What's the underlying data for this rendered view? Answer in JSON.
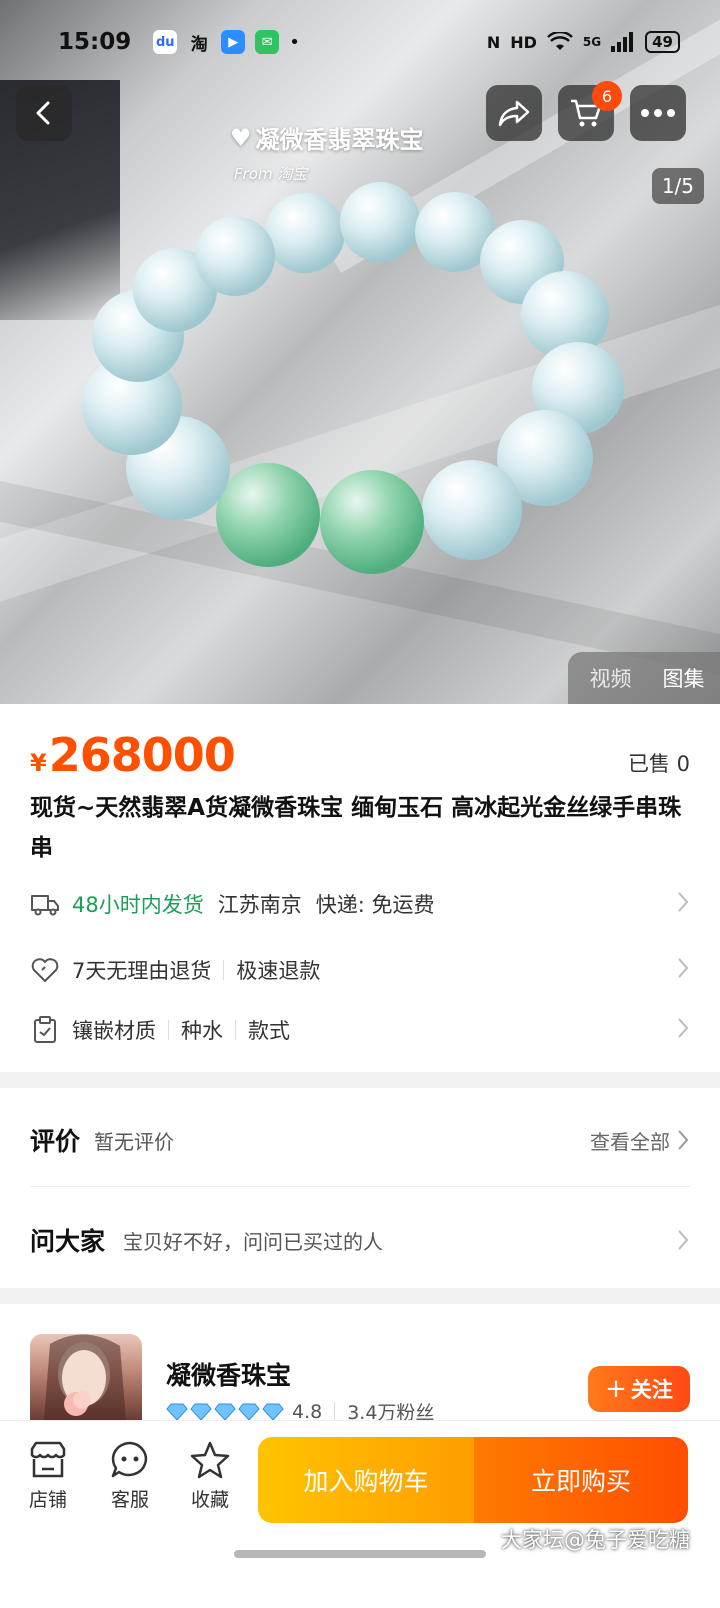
{
  "status_bar": {
    "time": "15:09",
    "apps": [
      "du",
      "淘",
      "▶",
      "✉"
    ],
    "network": "5G",
    "hd": "HD",
    "battery": "49"
  },
  "hero": {
    "watermark_title": "凝微香翡翠珠宝",
    "watermark_from": "From 淘宝",
    "page_indicator": "1/5",
    "media_tabs": [
      "视频",
      "图集"
    ],
    "cart_count": "6"
  },
  "product": {
    "currency": "¥",
    "price": "268000",
    "sold": "已售 0",
    "title": "现货~天然翡翠A货凝微香珠宝 缅甸玉石 高冰起光金丝绿手串珠串",
    "shipping": {
      "time": "48小时内发货",
      "origin": "江苏南京",
      "courier": "快递: 免运费"
    },
    "returns": {
      "policy": "7天无理由退货",
      "refund": "极速退款"
    },
    "specs": [
      "镶嵌材质",
      "种水",
      "款式"
    ]
  },
  "reviews": {
    "title": "评价",
    "empty": "暂无评价",
    "view_all": "查看全部",
    "ask_title": "问大家",
    "ask_sub": "宝贝好不好，问问已买过的人"
  },
  "shop": {
    "name": "凝微香珠宝",
    "rating": "4.8",
    "fans": "3.4万粉丝",
    "follow_label": "关注"
  },
  "bottom_bar": {
    "store_label": "店铺",
    "service_label": "客服",
    "fav_label": "收藏",
    "add_cart_label": "加入购物车",
    "buy_label": "立即购买"
  },
  "corner_watermark": "大家坛@兔子爱吃糖",
  "colors": {
    "price": "#ff5000",
    "green": "#1b9e57",
    "cart_btn": "#ffb000",
    "buy_btn": "#ff5a00"
  }
}
